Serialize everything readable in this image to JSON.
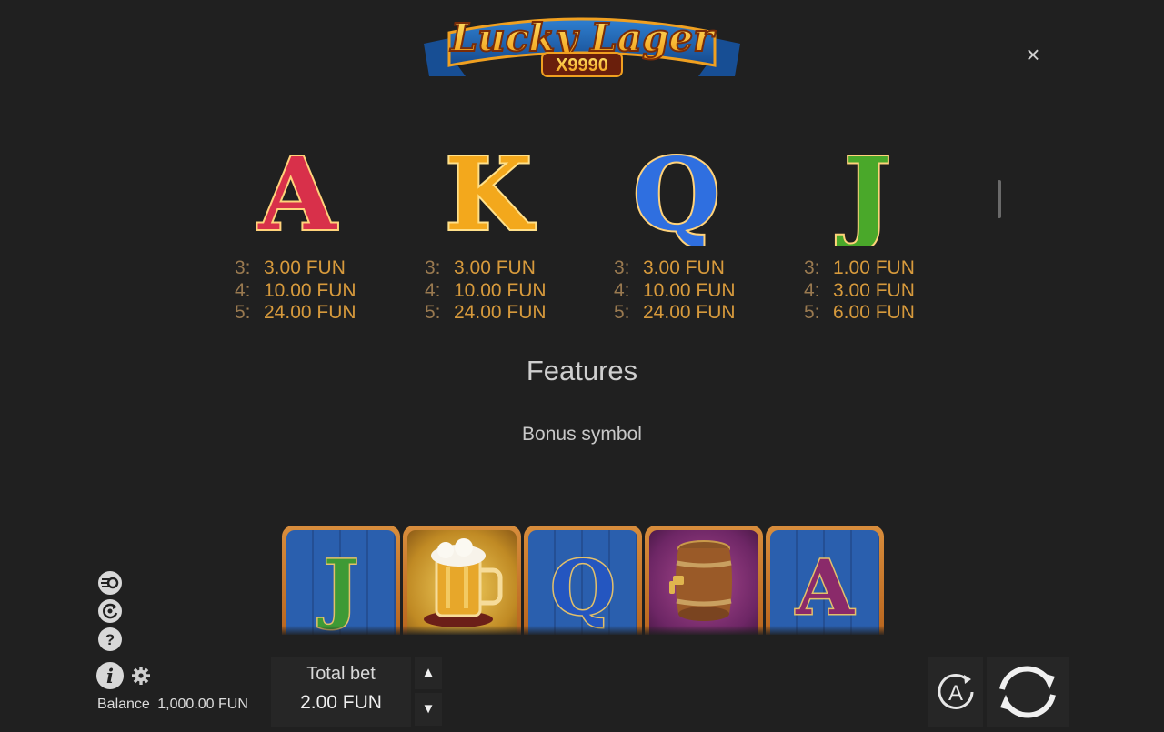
{
  "logo": {
    "title": "Lucky Lager",
    "multiplier": "X9990"
  },
  "close_label": "×",
  "paytable": [
    {
      "symbol": "A",
      "color": "#d8304a",
      "pays": [
        {
          "count": "3:",
          "value": "3.00 FUN"
        },
        {
          "count": "4:",
          "value": "10.00 FUN"
        },
        {
          "count": "5:",
          "value": "24.00 FUN"
        }
      ]
    },
    {
      "symbol": "K",
      "color": "#f3a81c",
      "pays": [
        {
          "count": "3:",
          "value": "3.00 FUN"
        },
        {
          "count": "4:",
          "value": "10.00 FUN"
        },
        {
          "count": "5:",
          "value": "24.00 FUN"
        }
      ]
    },
    {
      "symbol": "Q",
      "color": "#2f6fe0",
      "pays": [
        {
          "count": "3:",
          "value": "3.00 FUN"
        },
        {
          "count": "4:",
          "value": "10.00 FUN"
        },
        {
          "count": "5:",
          "value": "24.00 FUN"
        }
      ]
    },
    {
      "symbol": "J",
      "color": "#4aa82a",
      "pays": [
        {
          "count": "3:",
          "value": "1.00 FUN"
        },
        {
          "count": "4:",
          "value": "3.00 FUN"
        },
        {
          "count": "5:",
          "value": "6.00 FUN"
        }
      ]
    }
  ],
  "features": {
    "title": "Features",
    "bonus_label": "Bonus symbol"
  },
  "reel_preview": [
    {
      "kind": "letter",
      "symbol": "J",
      "color": "#3e9a35"
    },
    {
      "kind": "icon",
      "icon": "beer-mug-icon"
    },
    {
      "kind": "letter",
      "symbol": "Q",
      "color": "#2456c0"
    },
    {
      "kind": "icon",
      "icon": "barrel-icon"
    },
    {
      "kind": "letter",
      "symbol": "A",
      "color": "#8a2a6a"
    }
  ],
  "footer": {
    "balance_label": "Balance",
    "balance_value": "1,000.00 FUN",
    "total_bet_label": "Total bet",
    "total_bet_value": "2.00 FUN",
    "bet_up": "▲",
    "bet_down": "▼",
    "autoplay_label": "A"
  }
}
